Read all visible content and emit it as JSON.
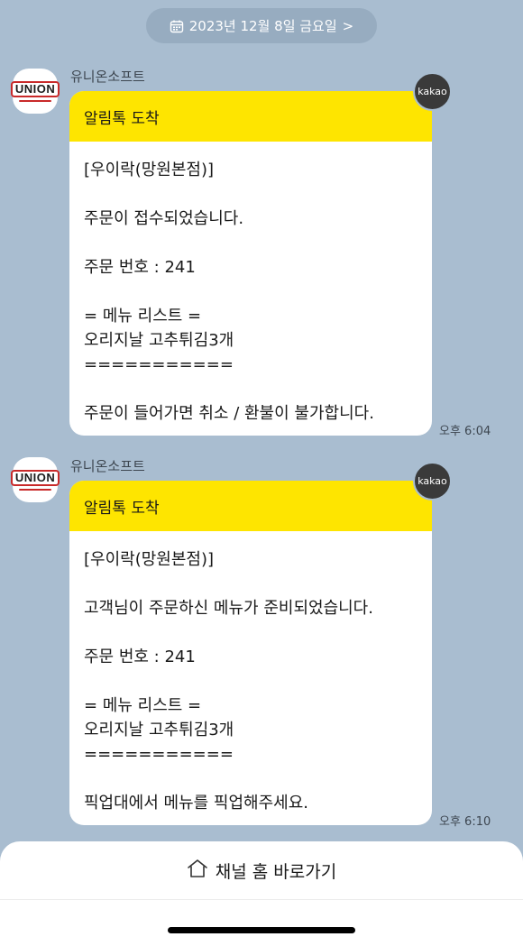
{
  "date_header": {
    "label": "2023년 12월 8일 금요일",
    "chevron": ">",
    "icon": "calendar-icon"
  },
  "messages": [
    {
      "sender": "유니온소프트",
      "logo_text": "UNION",
      "header": "알림톡 도착",
      "body": "[우이락(망원본점)]\n\n주문이 접수되었습니다.\n\n주문 번호 : 241\n\n= 메뉴 리스트 =\n오리지날 고추튀김3개\n===========\n\n주문이 들어가면 취소 / 환불이 불가합니다.",
      "badge": "kakao",
      "time": "오후 6:04"
    },
    {
      "sender": "유니온소프트",
      "logo_text": "UNION",
      "header": "알림톡 도착",
      "body": "[우이락(망원본점)]\n\n고객님이 주문하신 메뉴가 준비되었습니다.\n\n주문 번호 : 241\n\n= 메뉴 리스트 =\n오리지날 고추튀김3개\n===========\n\n픽업대에서 메뉴를 픽업해주세요.",
      "badge": "kakao",
      "time": "오후 6:10"
    }
  ],
  "bottom": {
    "channel_home_label": "채널 홈 바로가기",
    "icon": "home-icon"
  },
  "colors": {
    "background": "#a9bdd0",
    "header_yellow": "#fee500",
    "logo_red": "#c92a2a"
  }
}
